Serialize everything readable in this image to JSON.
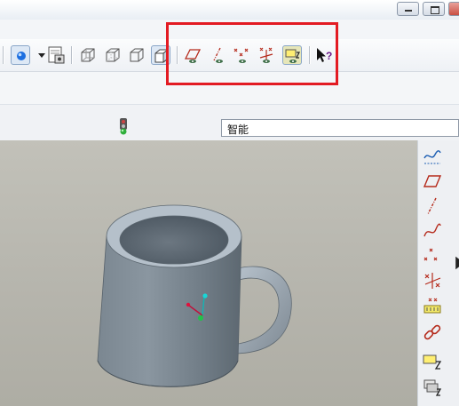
{
  "window": {
    "controls": [
      "minimize",
      "maximize",
      "close"
    ]
  },
  "toolbar": {
    "icons": [
      "datum-display-icon",
      "display-style-icon",
      "saved-views-icon",
      "wireframe-icon",
      "hidden-line-icon",
      "no-hidden-icon",
      "shading-icon",
      "datum-plane-display-icon",
      "datum-axis-display-icon",
      "datum-point-display-icon",
      "coordinate-system-display-icon",
      "annotation-display-icon",
      "context-help-icon"
    ]
  },
  "filter": {
    "value": "智能"
  },
  "right_toolbar": {
    "icons": [
      "sketched-curve-icon",
      "datum-plane-icon",
      "datum-axis-icon",
      "datum-curve-icon",
      "datum-point-icon",
      "coordinate-system-icon",
      "analysis-icon",
      "chain-icon",
      "annotation-icon",
      "layer-icon"
    ]
  },
  "colors": {
    "highlight": "#e31b23",
    "viewport": "#b9b8b0",
    "mug": "#7d8893"
  }
}
